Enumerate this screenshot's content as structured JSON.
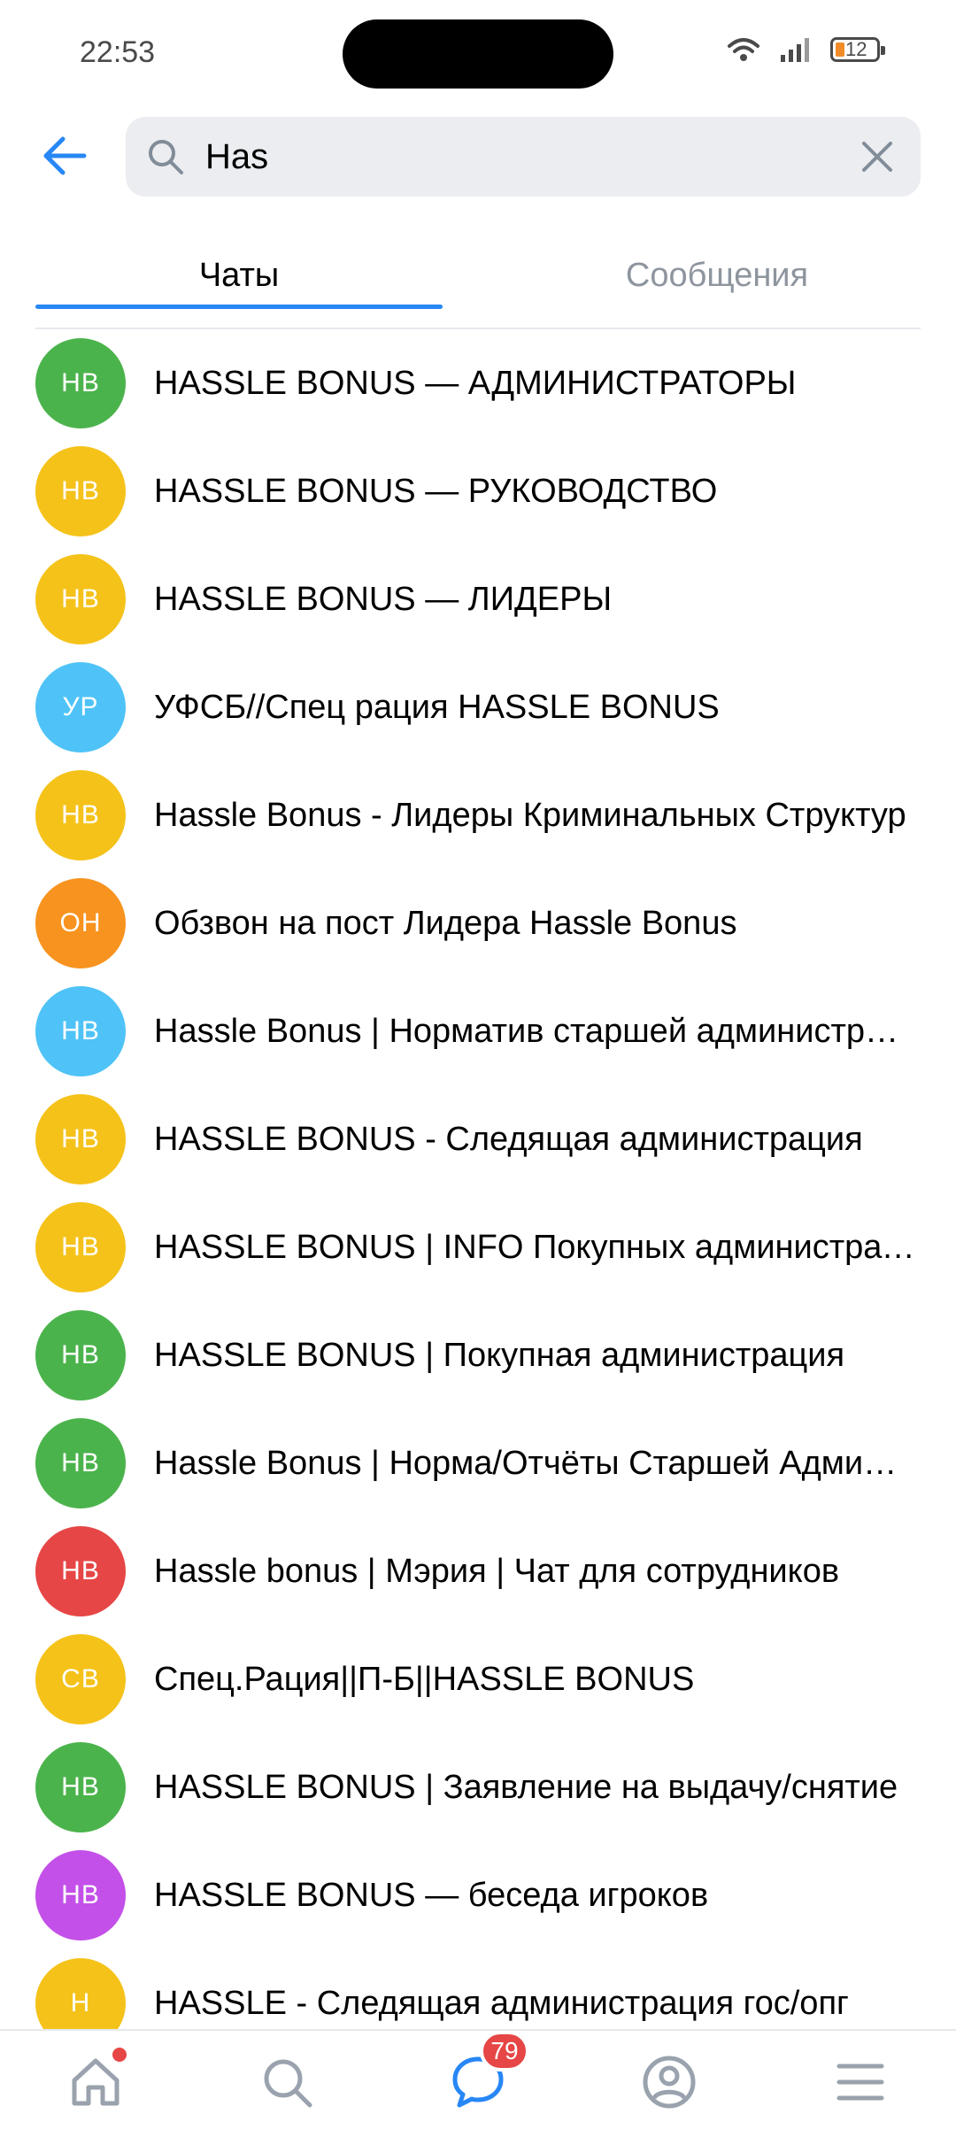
{
  "status": {
    "time": "22:53",
    "battery_level": "12"
  },
  "search": {
    "query": "Has",
    "placeholder": ""
  },
  "tabs": [
    {
      "label": "Чаты",
      "active": true
    },
    {
      "label": "Сообщения",
      "active": false
    }
  ],
  "chats": [
    {
      "initials": "HB",
      "title": "HASSLE BONUS — АДМИНИСТРАТОРЫ",
      "color": "#4bb34b"
    },
    {
      "initials": "HB",
      "title": "HASSLE BONUS — РУКОВОДСТВО",
      "color": "#f5c21a"
    },
    {
      "initials": "HB",
      "title": "HASSLE BONUS — ЛИДЕРЫ",
      "color": "#f5c21a"
    },
    {
      "initials": "УР",
      "title": "УФСБ//Спец рация HASSLE BONUS",
      "color": "#4fc3f7"
    },
    {
      "initials": "HB",
      "title": "Hassle Bonus - Лидеры Криминальных Структур",
      "color": "#f5c21a"
    },
    {
      "initials": "OH",
      "title": "Обзвон на пост Лидера Hassle Bonus",
      "color": "#f7931e"
    },
    {
      "initials": "HB",
      "title": "Hassle Bonus | Норматив старшей администрации",
      "color": "#4fc3f7"
    },
    {
      "initials": "HB",
      "title": "HASSLE BONUS - Следящая администрация",
      "color": "#f5c21a"
    },
    {
      "initials": "HB",
      "title": "HASSLE BONUS | INFO Покупных администраторов",
      "color": "#f5c21a"
    },
    {
      "initials": "HB",
      "title": "HASSLE BONUS | Покупная администрация",
      "color": "#4bb34b"
    },
    {
      "initials": "HB",
      "title": "Hassle Bonus | Норма/Отчёты Старшей Администрации",
      "color": "#4bb34b"
    },
    {
      "initials": "HB",
      "title": "Hassle bonus | Мэрия | Чат для сотрудников",
      "color": "#e64646"
    },
    {
      "initials": "CB",
      "title": "Спец.Рация||П-Б||HASSLE BONUS",
      "color": "#f5c21a"
    },
    {
      "initials": "HB",
      "title": "HASSLE BONUS | Заявление на выдачу/снятие",
      "color": "#4bb34b"
    },
    {
      "initials": "HB",
      "title": "HASSLE BONUS — беседа игроков",
      "color": "#c350e8"
    },
    {
      "initials": "H",
      "title": "HASSLE - Следящая администрация гос/опг",
      "color": "#f5c21a"
    }
  ],
  "bottom_nav": {
    "items": [
      {
        "icon": "home-icon",
        "has_dot": true
      },
      {
        "icon": "search-icon"
      },
      {
        "icon": "messages-icon",
        "badge": "79"
      },
      {
        "icon": "profile-icon"
      },
      {
        "icon": "menu-icon"
      }
    ]
  },
  "colors": {
    "accent": "#2787f5",
    "badge": "#e64646"
  }
}
